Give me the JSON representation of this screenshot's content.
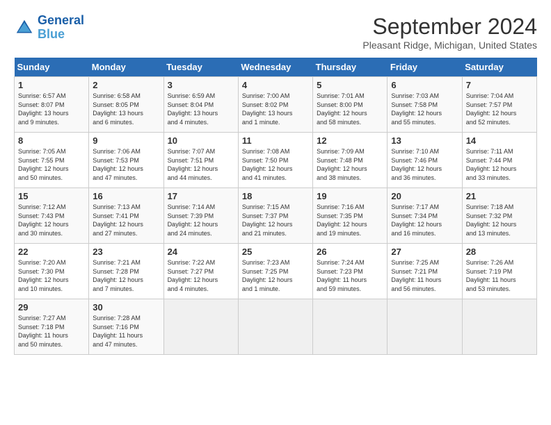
{
  "header": {
    "logo_line1": "General",
    "logo_line2": "Blue",
    "month": "September 2024",
    "location": "Pleasant Ridge, Michigan, United States"
  },
  "weekdays": [
    "Sunday",
    "Monday",
    "Tuesday",
    "Wednesday",
    "Thursday",
    "Friday",
    "Saturday"
  ],
  "weeks": [
    [
      {
        "day": "1",
        "info": "Sunrise: 6:57 AM\nSunset: 8:07 PM\nDaylight: 13 hours\nand 9 minutes."
      },
      {
        "day": "2",
        "info": "Sunrise: 6:58 AM\nSunset: 8:05 PM\nDaylight: 13 hours\nand 6 minutes."
      },
      {
        "day": "3",
        "info": "Sunrise: 6:59 AM\nSunset: 8:04 PM\nDaylight: 13 hours\nand 4 minutes."
      },
      {
        "day": "4",
        "info": "Sunrise: 7:00 AM\nSunset: 8:02 PM\nDaylight: 13 hours\nand 1 minute."
      },
      {
        "day": "5",
        "info": "Sunrise: 7:01 AM\nSunset: 8:00 PM\nDaylight: 12 hours\nand 58 minutes."
      },
      {
        "day": "6",
        "info": "Sunrise: 7:03 AM\nSunset: 7:58 PM\nDaylight: 12 hours\nand 55 minutes."
      },
      {
        "day": "7",
        "info": "Sunrise: 7:04 AM\nSunset: 7:57 PM\nDaylight: 12 hours\nand 52 minutes."
      }
    ],
    [
      {
        "day": "8",
        "info": "Sunrise: 7:05 AM\nSunset: 7:55 PM\nDaylight: 12 hours\nand 50 minutes."
      },
      {
        "day": "9",
        "info": "Sunrise: 7:06 AM\nSunset: 7:53 PM\nDaylight: 12 hours\nand 47 minutes."
      },
      {
        "day": "10",
        "info": "Sunrise: 7:07 AM\nSunset: 7:51 PM\nDaylight: 12 hours\nand 44 minutes."
      },
      {
        "day": "11",
        "info": "Sunrise: 7:08 AM\nSunset: 7:50 PM\nDaylight: 12 hours\nand 41 minutes."
      },
      {
        "day": "12",
        "info": "Sunrise: 7:09 AM\nSunset: 7:48 PM\nDaylight: 12 hours\nand 38 minutes."
      },
      {
        "day": "13",
        "info": "Sunrise: 7:10 AM\nSunset: 7:46 PM\nDaylight: 12 hours\nand 36 minutes."
      },
      {
        "day": "14",
        "info": "Sunrise: 7:11 AM\nSunset: 7:44 PM\nDaylight: 12 hours\nand 33 minutes."
      }
    ],
    [
      {
        "day": "15",
        "info": "Sunrise: 7:12 AM\nSunset: 7:43 PM\nDaylight: 12 hours\nand 30 minutes."
      },
      {
        "day": "16",
        "info": "Sunrise: 7:13 AM\nSunset: 7:41 PM\nDaylight: 12 hours\nand 27 minutes."
      },
      {
        "day": "17",
        "info": "Sunrise: 7:14 AM\nSunset: 7:39 PM\nDaylight: 12 hours\nand 24 minutes."
      },
      {
        "day": "18",
        "info": "Sunrise: 7:15 AM\nSunset: 7:37 PM\nDaylight: 12 hours\nand 21 minutes."
      },
      {
        "day": "19",
        "info": "Sunrise: 7:16 AM\nSunset: 7:35 PM\nDaylight: 12 hours\nand 19 minutes."
      },
      {
        "day": "20",
        "info": "Sunrise: 7:17 AM\nSunset: 7:34 PM\nDaylight: 12 hours\nand 16 minutes."
      },
      {
        "day": "21",
        "info": "Sunrise: 7:18 AM\nSunset: 7:32 PM\nDaylight: 12 hours\nand 13 minutes."
      }
    ],
    [
      {
        "day": "22",
        "info": "Sunrise: 7:20 AM\nSunset: 7:30 PM\nDaylight: 12 hours\nand 10 minutes."
      },
      {
        "day": "23",
        "info": "Sunrise: 7:21 AM\nSunset: 7:28 PM\nDaylight: 12 hours\nand 7 minutes."
      },
      {
        "day": "24",
        "info": "Sunrise: 7:22 AM\nSunset: 7:27 PM\nDaylight: 12 hours\nand 4 minutes."
      },
      {
        "day": "25",
        "info": "Sunrise: 7:23 AM\nSunset: 7:25 PM\nDaylight: 12 hours\nand 1 minute."
      },
      {
        "day": "26",
        "info": "Sunrise: 7:24 AM\nSunset: 7:23 PM\nDaylight: 11 hours\nand 59 minutes."
      },
      {
        "day": "27",
        "info": "Sunrise: 7:25 AM\nSunset: 7:21 PM\nDaylight: 11 hours\nand 56 minutes."
      },
      {
        "day": "28",
        "info": "Sunrise: 7:26 AM\nSunset: 7:19 PM\nDaylight: 11 hours\nand 53 minutes."
      }
    ],
    [
      {
        "day": "29",
        "info": "Sunrise: 7:27 AM\nSunset: 7:18 PM\nDaylight: 11 hours\nand 50 minutes."
      },
      {
        "day": "30",
        "info": "Sunrise: 7:28 AM\nSunset: 7:16 PM\nDaylight: 11 hours\nand 47 minutes."
      },
      {
        "day": "",
        "info": ""
      },
      {
        "day": "",
        "info": ""
      },
      {
        "day": "",
        "info": ""
      },
      {
        "day": "",
        "info": ""
      },
      {
        "day": "",
        "info": ""
      }
    ]
  ]
}
